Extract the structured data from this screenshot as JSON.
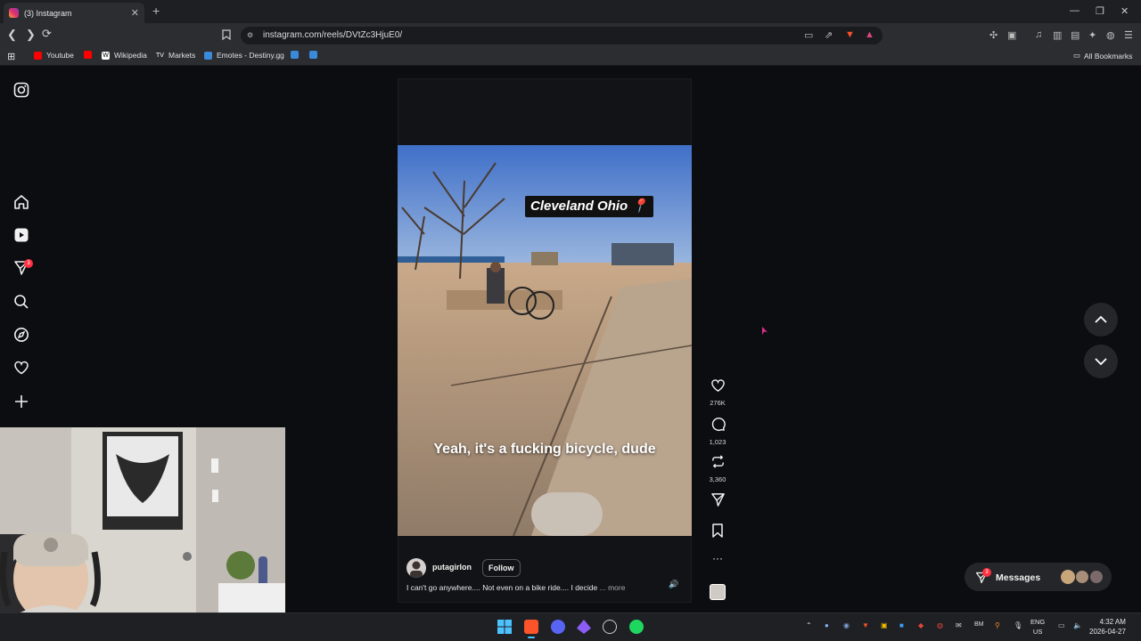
{
  "browser": {
    "tab_title": "(3) Instagram",
    "tab_badge": "3",
    "url": "instagram.com/reels/DVtZc3HjuE0/",
    "bookmarks": [
      "Youtube",
      "Wikipedia",
      "Markets",
      "Emotes - Destiny.gg"
    ],
    "all_bookmarks": "All Bookmarks"
  },
  "sidebar": {
    "notification_count": "3",
    "icons": [
      "instagram-logo-icon",
      "home-icon",
      "reels-icon",
      "direct-send-icon",
      "search-icon",
      "explore-icon",
      "heart-icon",
      "create-plus-icon"
    ]
  },
  "reel": {
    "location_sticker": "Cleveland Ohio 📍",
    "subtitle": "Yeah, it's a fucking bicycle, dude",
    "username": "putagirlon",
    "follow_label": "Follow",
    "caption": "I can't go anywhere.... Not even on a bike ride.... I decide",
    "caption_more": "... more",
    "likes": "276K",
    "comments": "1,023",
    "reposts": "3,360"
  },
  "messages": {
    "label": "Messages",
    "badge": "3"
  },
  "taskbar": {
    "lang_top": "ENG",
    "lang_bottom": "US",
    "time": "4:32 AM",
    "date": "2026-04-27"
  },
  "colors": {
    "accent_red": "#ff3040",
    "page_bg": "#0c0d10",
    "chrome_bg": "#2b2d31"
  }
}
